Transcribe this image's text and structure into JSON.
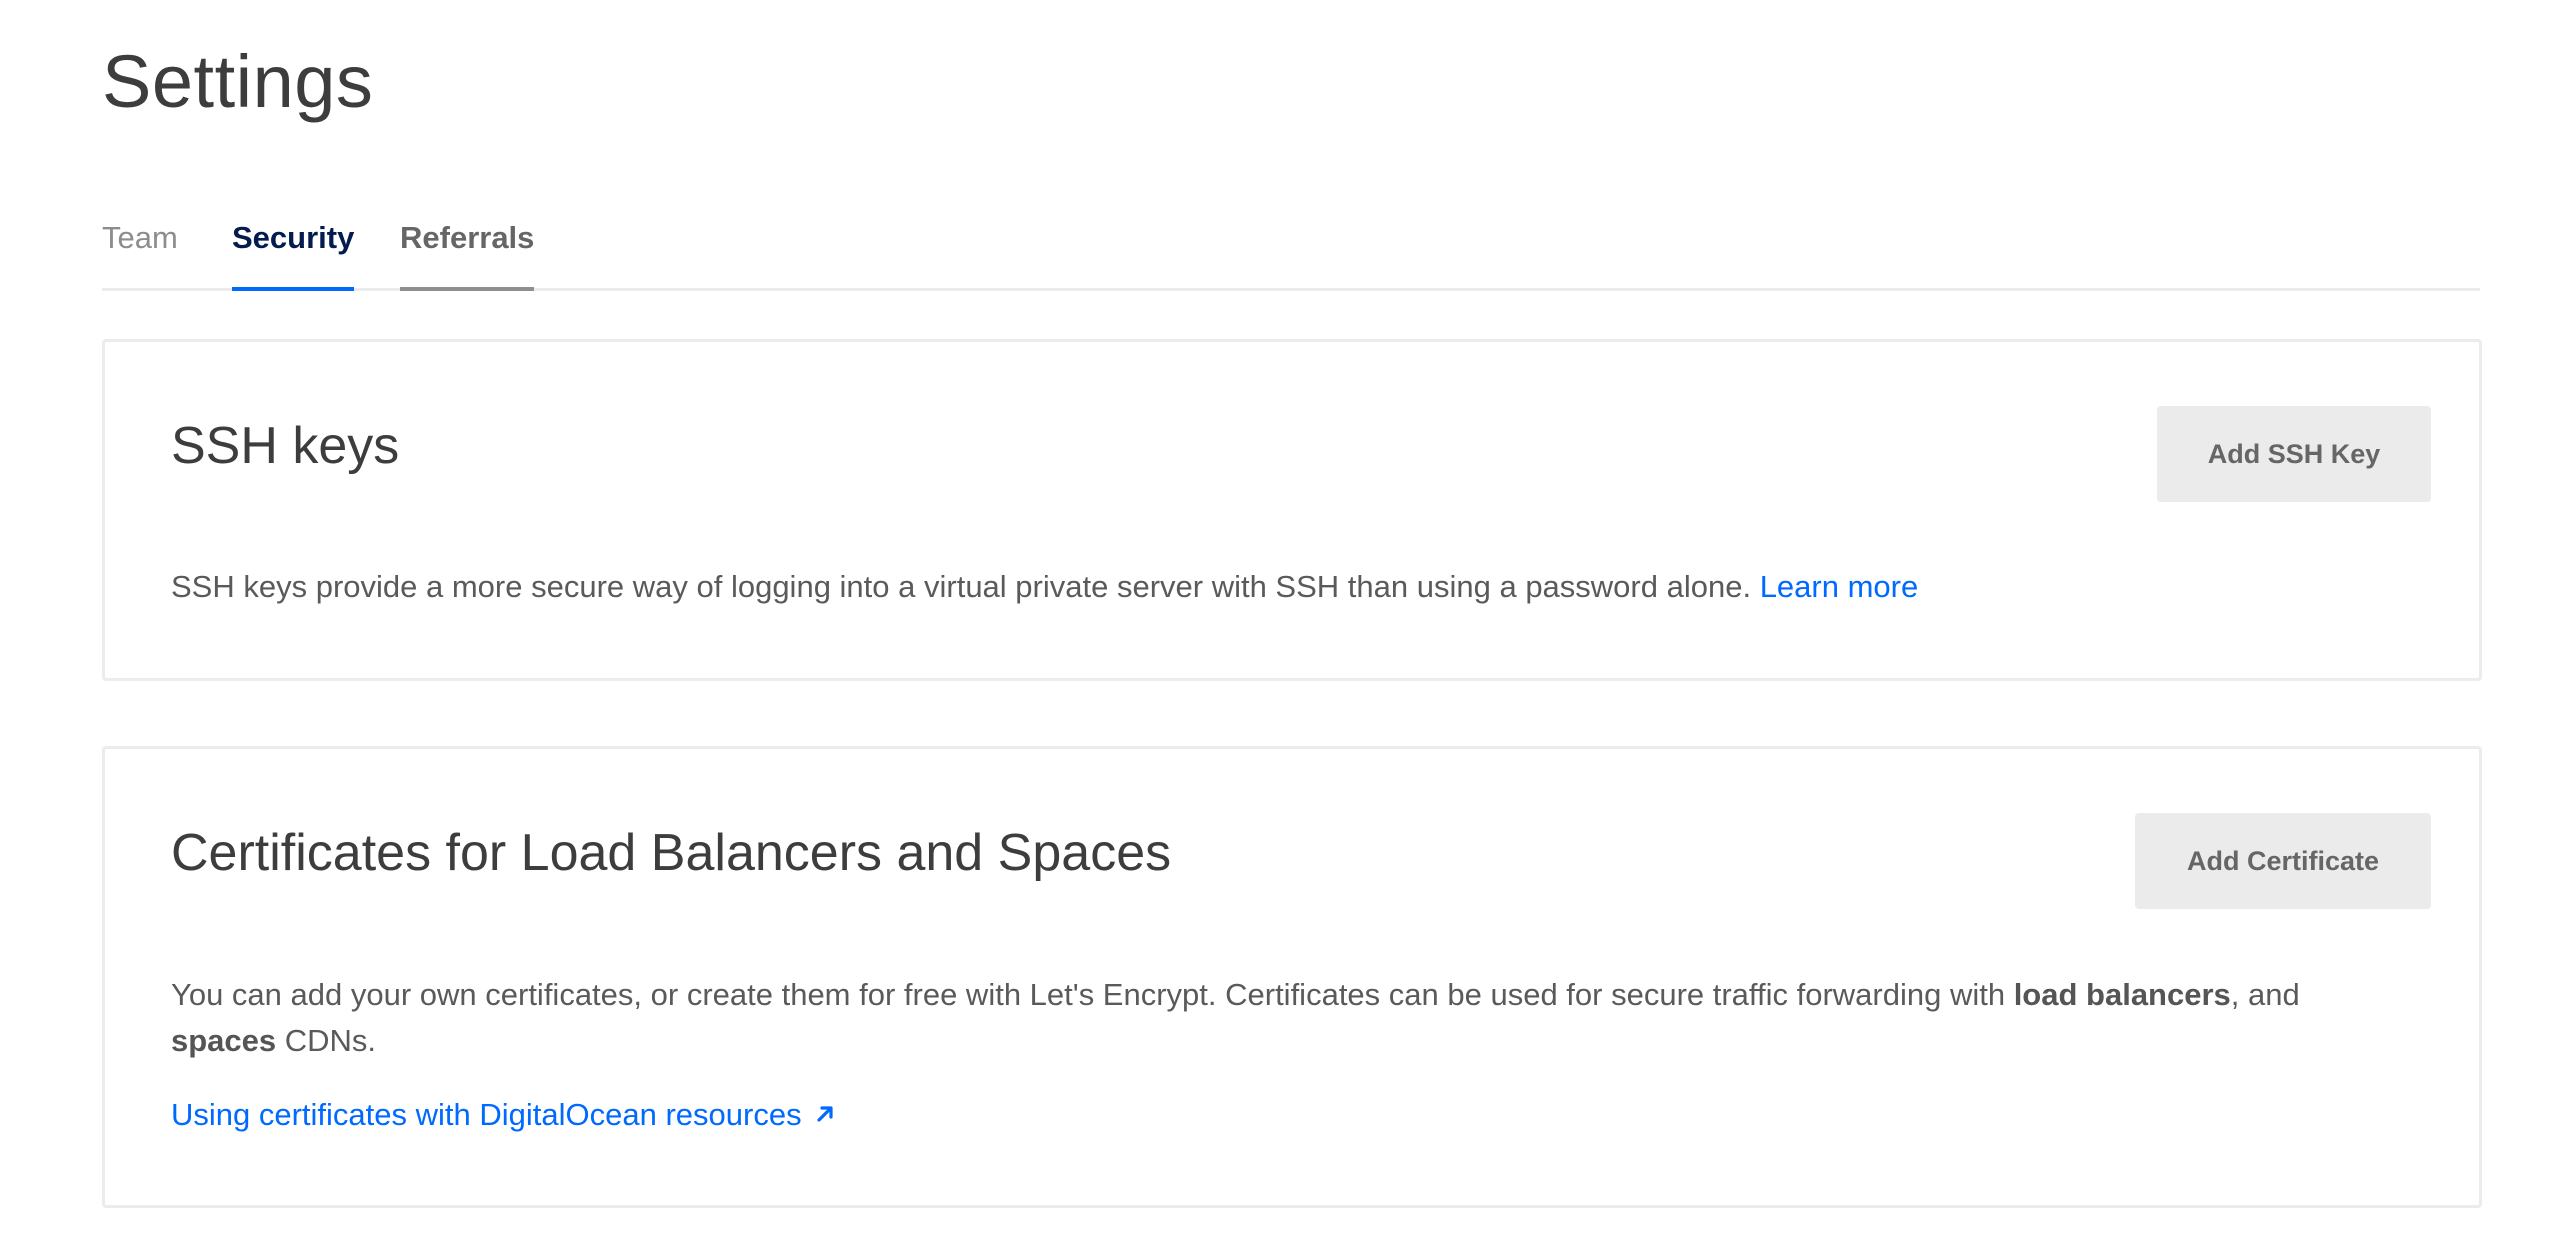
{
  "page": {
    "title": "Settings"
  },
  "tabs": [
    {
      "label": "Team",
      "active": false
    },
    {
      "label": "Security",
      "active": true
    },
    {
      "label": "Referrals",
      "active": false
    }
  ],
  "ssh_keys": {
    "heading": "SSH keys",
    "button_label": "Add SSH Key",
    "description": "SSH keys provide a more secure way of logging into a virtual private server with SSH than using a password alone.",
    "link_label": "Learn more"
  },
  "certificates": {
    "heading": "Certificates for Load Balancers and Spaces",
    "button_label": "Add Certificate",
    "description_part1": "You can add your own certificates, or create them for free with Let's Encrypt. Certificates can be used for secure traffic forwarding with ",
    "bold_load_balancers": "load balancers",
    "description_part2": ", and ",
    "bold_spaces": "spaces",
    "description_part3": " CDNs.",
    "link_label": "Using certificates with DigitalOcean resources",
    "link_icon": "external-arrow-icon"
  },
  "colors": {
    "accent": "#0069ff",
    "active_tab_text": "#031b4e",
    "button_bg": "#ebebeb",
    "border": "#ececec"
  }
}
